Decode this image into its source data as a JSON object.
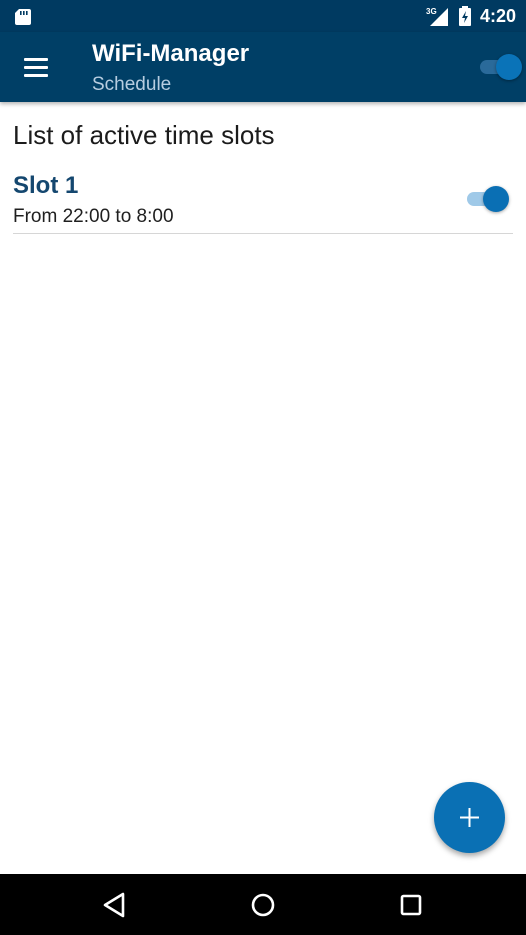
{
  "status_bar": {
    "network_label": "3G",
    "time": "4:20",
    "icons": [
      "sd-card-icon",
      "signal-icon",
      "battery-icon"
    ]
  },
  "app_bar": {
    "title": "WiFi-Manager",
    "subtitle": "Schedule",
    "menu_icon": "hamburger-menu-icon",
    "master_switch_on": true
  },
  "content": {
    "heading": "List of active time slots",
    "slots": [
      {
        "name": "Slot 1",
        "time_range": "From 22:00 to 8:00",
        "enabled": true
      }
    ]
  },
  "fab": {
    "icon": "plus-icon"
  },
  "nav_bar": {
    "buttons": [
      "back-icon",
      "home-icon",
      "recents-icon"
    ]
  },
  "colors": {
    "status_bar": "#003a61",
    "app_bar": "#003f66",
    "accent": "#0a70b4",
    "slot_title": "#14476f",
    "subtitle": "#b7cde0"
  }
}
